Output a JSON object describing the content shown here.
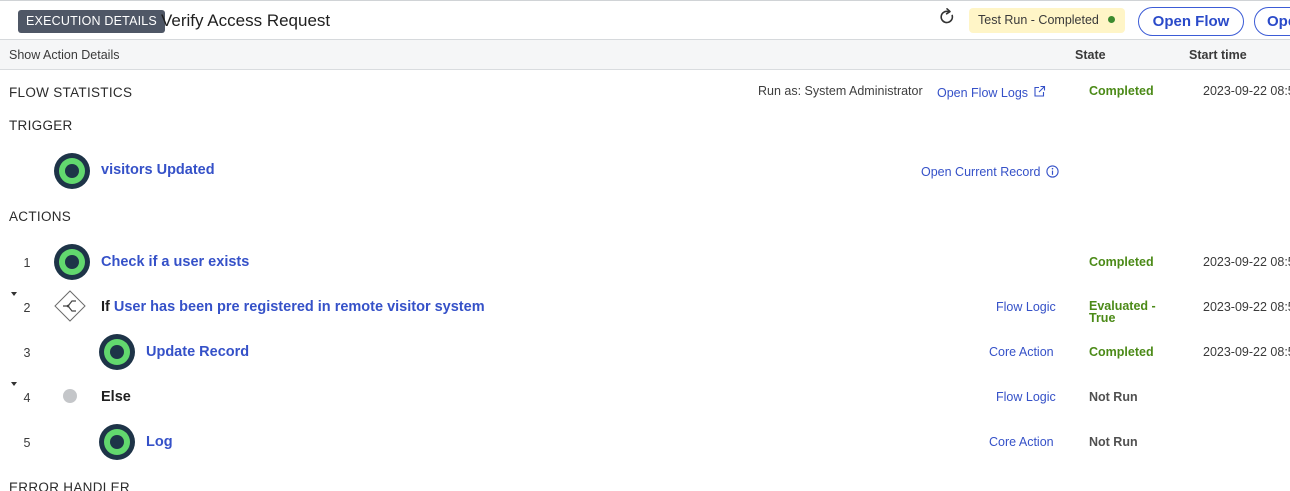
{
  "header": {
    "badge": "EXECUTION DETAILS",
    "title": "Verify Access Request",
    "status": "Test Run - Completed",
    "open_flow": "Open Flow",
    "open_second": "Ope"
  },
  "columns": {
    "show_details": "Show Action Details",
    "state": "State",
    "start_time": "Start time"
  },
  "flow_statistics": {
    "title": "FLOW STATISTICS",
    "run_as": "Run as: System Administrator",
    "logs_link": "Open Flow Logs",
    "state": "Completed",
    "time": "2023-09-22 08:5"
  },
  "trigger": {
    "title": "TRIGGER",
    "name": "visitors Updated",
    "record_link": "Open Current Record"
  },
  "actions": {
    "title": "ACTIONS",
    "rows": [
      {
        "num": "1",
        "label": "Check if a user exists",
        "type": "",
        "state": "Completed",
        "time": "2023-09-22 08:5"
      },
      {
        "num": "2",
        "keyword": "If",
        "label": "User has been pre registered in remote visitor system",
        "type": "Flow Logic",
        "state_line1": "Evaluated -",
        "state_line2": "True",
        "time": "2023-09-22 08:5"
      },
      {
        "num": "3",
        "label": "Update Record",
        "type": "Core Action",
        "state": "Completed",
        "time": "2023-09-22 08:5"
      },
      {
        "num": "4",
        "label": "Else",
        "type": "Flow Logic",
        "state": "Not Run",
        "time": ""
      },
      {
        "num": "5",
        "label": "Log",
        "type": "Core Action",
        "state": "Not Run",
        "time": ""
      }
    ]
  },
  "error_handler": {
    "title": "ERROR HANDLER"
  },
  "colors": {
    "link": "#3551c8",
    "completed": "#4b8a17",
    "badge": "#4f5766",
    "status_pill": "#fff5c7"
  }
}
